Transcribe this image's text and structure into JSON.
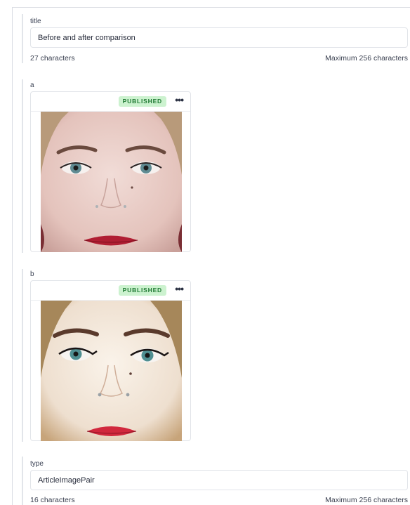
{
  "fields": {
    "title": {
      "label": "title",
      "value": "Before and after comparison",
      "count": "27 characters",
      "max": "Maximum 256 characters"
    },
    "a": {
      "label": "a",
      "status": "PUBLISHED",
      "more": "•••",
      "image_alt": "close-up portrait of a woman's face (before)"
    },
    "b": {
      "label": "b",
      "status": "PUBLISHED",
      "more": "•••",
      "image_alt": "close-up portrait of a woman's face (after)"
    },
    "type": {
      "label": "type",
      "value": "ArticleImagePair",
      "count": "16 characters",
      "max": "Maximum 256 characters"
    }
  },
  "colors": {
    "badge_bg": "#ccf2cf",
    "badge_text": "#1f7a33",
    "border": "#e1e4e9"
  }
}
